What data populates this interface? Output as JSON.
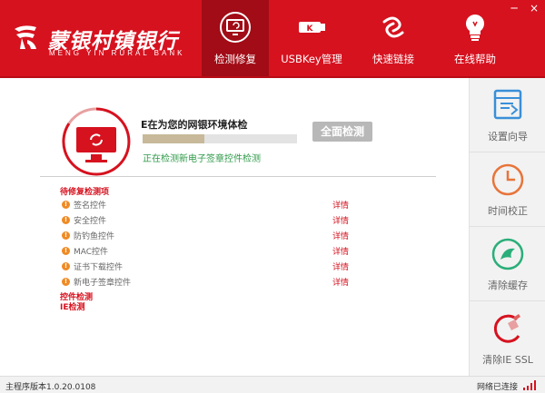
{
  "app": {
    "logo_text": "蒙银村镇银行",
    "logo_sub": "MENG  YIN  RURAL  BANK",
    "brand_color": "#d6121f",
    "window_controls": [
      "─",
      "×"
    ]
  },
  "nav": [
    {
      "label": "检测修复",
      "icon": "monitor-refresh-icon",
      "active": true
    },
    {
      "label": "USBKey管理",
      "icon": "usb-key-icon",
      "active": false
    },
    {
      "label": "快速链接",
      "icon": "link-icon",
      "active": false
    },
    {
      "label": "在线帮助",
      "icon": "lightbulb-icon",
      "active": false
    }
  ],
  "check": {
    "title": "E在为您的网银环境体检",
    "progress": 0.4,
    "scan_button": "全面检测",
    "status": "正在检测新电子签章控件检测"
  },
  "items_title": "待修复检测项",
  "items": [
    {
      "name": "签名控件",
      "detail": "详情"
    },
    {
      "name": "安全控件",
      "detail": "详情"
    },
    {
      "name": "防钓鱼控件",
      "detail": "详情"
    },
    {
      "name": "MAC控件",
      "detail": "详情"
    },
    {
      "name": "证书下载控件",
      "detail": "详情"
    },
    {
      "name": "新电子签章控件",
      "detail": "详情"
    }
  ],
  "sections": [
    "控件检测",
    "IE检测"
  ],
  "sidebar": [
    {
      "label": "设置向导",
      "icon": "wizard-icon"
    },
    {
      "label": "时间校正",
      "icon": "clock-icon"
    },
    {
      "label": "清除缓存",
      "icon": "clear-cache-icon"
    },
    {
      "label": "清除IE SSL",
      "icon": "broom-icon"
    }
  ],
  "statusbar": {
    "version": "主程序版本1.0.20.0108",
    "network": "网络已连接"
  }
}
